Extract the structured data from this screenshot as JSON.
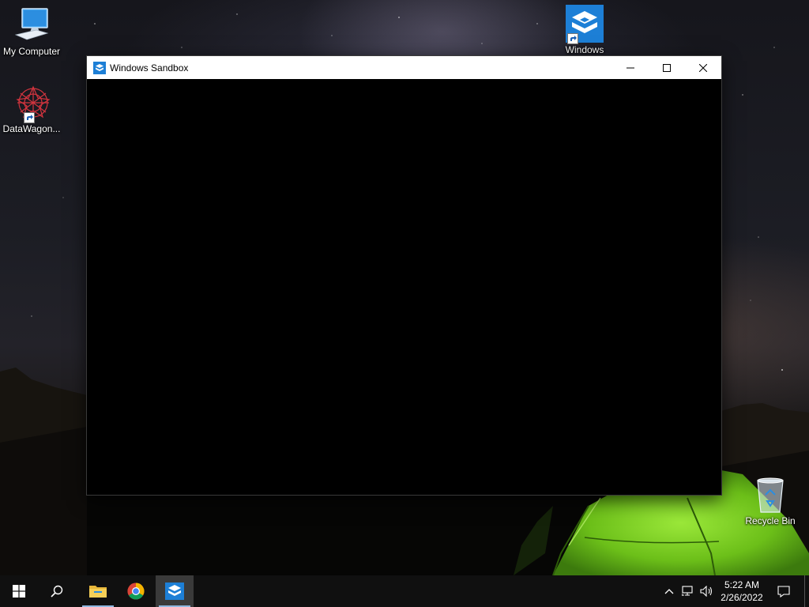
{
  "desktop": {
    "icons": [
      {
        "label": "My Computer",
        "icon": "computer-icon"
      },
      {
        "label": "DataWagon...",
        "icon": "datawagon-icon"
      },
      {
        "label": "Windows",
        "icon": "sandbox-icon"
      },
      {
        "label": "Recycle Bin",
        "icon": "recycle-bin-icon"
      }
    ]
  },
  "window": {
    "title": "Windows Sandbox",
    "icon": "sandbox-icon",
    "controls": {
      "minimize": "minimize-icon",
      "maximize": "maximize-icon",
      "close": "close-icon"
    }
  },
  "taskbar": {
    "start": "windows-logo-icon",
    "search": "search-icon",
    "apps": [
      {
        "name": "File Explorer",
        "icon": "folder-icon",
        "running": true,
        "active": false
      },
      {
        "name": "Google Chrome",
        "icon": "chrome-icon",
        "running": false,
        "active": false
      },
      {
        "name": "Windows Sandbox",
        "icon": "sandbox-icon",
        "running": true,
        "active": true
      }
    ],
    "tray": {
      "overflow_icon": "chevron-up-icon",
      "network_icon": "network-icon",
      "volume_icon": "volume-icon",
      "time": "5:22 AM",
      "date": "2/26/2022",
      "notification_icon": "action-center-icon"
    }
  },
  "colors": {
    "sandbox_blue": "#1d7fd6",
    "taskbar": "#101010",
    "active_underline": "#8fb8e0",
    "tent_green": "#7ed321"
  }
}
